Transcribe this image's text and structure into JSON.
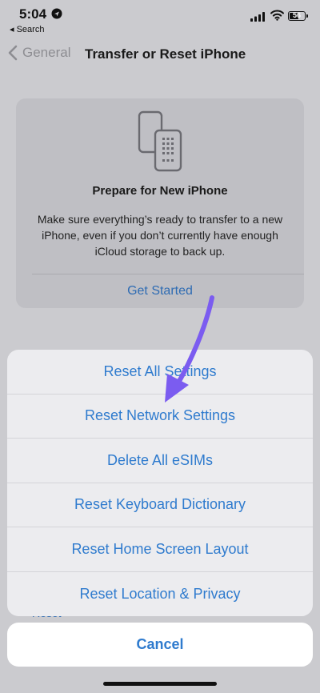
{
  "status_bar": {
    "time": "5:04",
    "back_app": "◂ Search",
    "battery": "56"
  },
  "nav": {
    "back_label": "General",
    "title": "Transfer or Reset iPhone"
  },
  "prepare_card": {
    "title": "Prepare for New iPhone",
    "description": "Make sure everything’s ready to transfer to a new iPhone, even if you don’t currently have enough iCloud storage to back up.",
    "action": "Get Started"
  },
  "partially_hidden_text": "Reset",
  "action_sheet": {
    "items": [
      "Reset All Settings",
      "Reset Network Settings",
      "Delete All eSIMs",
      "Reset Keyboard Dictionary",
      "Reset Home Screen Layout",
      "Reset Location & Privacy"
    ],
    "cancel": "Cancel"
  },
  "colors": {
    "accent": "#2f7bce",
    "annotation_arrow": "#7b5cf0",
    "dimmed_background": "#cbcbcf"
  },
  "icons": [
    "location-arrow-icon",
    "cellular-signal-icon",
    "wifi-icon",
    "battery-icon",
    "chevron-left-icon",
    "transfer-phones-icon",
    "annotation-arrow"
  ]
}
